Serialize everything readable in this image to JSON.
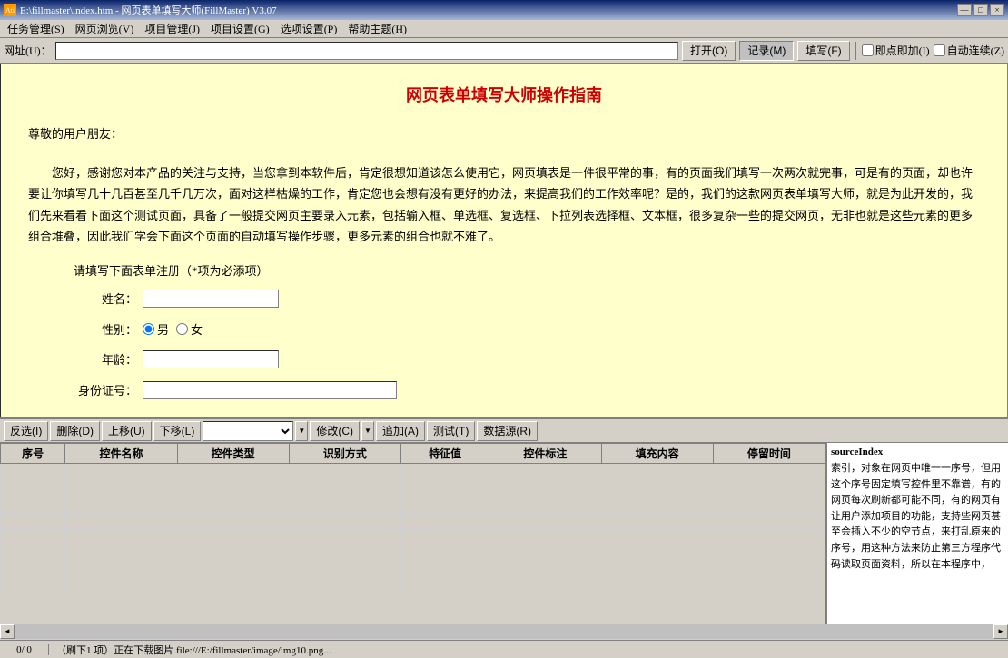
{
  "window": {
    "title": "E:\\fillmaster\\index.htm - 网页表单填写大师(FillMaster) V3.07",
    "icon": "Ati",
    "controls": {
      "minimize": "—",
      "restore": "□",
      "close": "×"
    }
  },
  "menubar": {
    "items": [
      {
        "id": "task",
        "label": "任务管理(S)"
      },
      {
        "id": "browse",
        "label": "网页浏览(V)"
      },
      {
        "id": "project-mgr",
        "label": "项目管理(J)"
      },
      {
        "id": "project-set",
        "label": "项目设置(G)"
      },
      {
        "id": "options",
        "label": "选项设置(P)"
      },
      {
        "id": "help",
        "label": "帮助主题(H)"
      }
    ]
  },
  "toolbar": {
    "url_label": "网址(U)：",
    "url_value": "",
    "open_btn": "打开(O)",
    "record_btn": "记录(M)",
    "fill_btn": "填写(F)",
    "instant_label": "□ 即点即加(I)",
    "auto_label": "□ 自动连续(Z)"
  },
  "browser": {
    "page_title": "网页表单填写大师操作指南",
    "greeting": "尊敬的用户朋友：",
    "intro": "您好，感谢您对本产品的关注与支持，当您拿到本软件后，肯定很想知道该怎么使用它，网页填表是一件很平常的事，有的页面我们填写一次两次就完事，可是有的页面，却也许要让你填写几十几百甚至几千几万次，面对这样枯燥的工作，肯定您也会想有没有更好的办法，来提高我们的工作效率呢？是的，我们的这款网页表单填写大师，就是为此开发的，我们先来看看下面这个测试页面，具备了一般提交网页主要录入元素，包括输入框、单选框、复选框、下拉列表选择框、文本框，很多复杂一些的提交网页，无非也就是这些元素的更多组合堆叠，因此我们学会下面这个页面的自动填写操作步骤，更多元素的组合也就不难了。",
    "form_instruction": "请填写下面表单注册（*项为必添项）",
    "fields": {
      "name_label": "姓名：",
      "name_value": "",
      "gender_label": "性别：",
      "gender_male": "男",
      "gender_female": "女",
      "age_label": "年龄：",
      "age_value": "",
      "id_label": "身份证号：",
      "id_value": ""
    }
  },
  "bottom_toolbar": {
    "buttons": [
      {
        "id": "filter",
        "label": "反选(I)"
      },
      {
        "id": "delete",
        "label": "删除(D)"
      },
      {
        "id": "move-up",
        "label": "上移(U)"
      },
      {
        "id": "move-down",
        "label": "下移(L)"
      },
      {
        "id": "modify",
        "label": "修改(C)"
      },
      {
        "id": "add",
        "label": "追加(A)"
      },
      {
        "id": "test",
        "label": "测试(T)"
      },
      {
        "id": "datasource",
        "label": "数据源(R)"
      }
    ],
    "dropdown_placeholder": ""
  },
  "table": {
    "columns": [
      "序号",
      "控件名称",
      "控件类型",
      "识别方式",
      "特征值",
      "控件标注",
      "填充内容",
      "停留时间"
    ],
    "rows": []
  },
  "side_panel": {
    "title": "sourceIndex",
    "content": "索引，对象在网页中唯一一序号，但用这个序号固定填写控件里不靠谱，有的网页每次刷新都可能不同，有的网页有让用户添加项目的功能，支持些网页甚至会插入不少的空节点，来打乱原来的序号，用这种方法来防止第三方程序代码读取页面资料，所以在本程序中，"
  },
  "status_bar": {
    "count": "0/ 0",
    "message": "（刷下1 项）正在下载图片 file:///E:/fillmaster/image/img10.png..."
  }
}
